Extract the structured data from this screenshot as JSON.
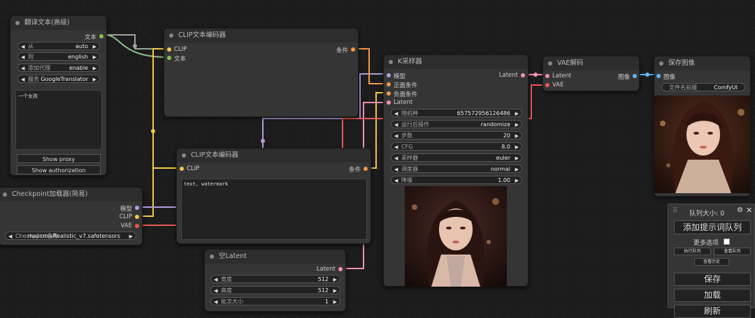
{
  "nodes": {
    "translate": {
      "title": "翻译文本(高级)",
      "out_text": "文本",
      "widgets": [
        {
          "label": "从",
          "value": "auto"
        },
        {
          "label": "到",
          "value": "english"
        },
        {
          "label": "添加代理",
          "value": "enable"
        },
        {
          "label": "服务",
          "value": "GoogleTranslator"
        }
      ],
      "text": "一个女孩",
      "btn_proxy": "Show proxy",
      "btn_auth": "Show authorization"
    },
    "clip1": {
      "title": "CLIP文本编码器",
      "in_clip": "CLIP",
      "in_text": "文本",
      "out_cond": "条件"
    },
    "clip2": {
      "title": "CLIP文本编码器",
      "in_clip": "CLIP",
      "out_cond": "条件",
      "text": "text, watermark"
    },
    "checkpoint": {
      "title": "Checkpoint加载器(简易)",
      "out_model": "模型",
      "out_clip": "CLIP",
      "out_vae": "VAE",
      "widget_label": "Checkpoint名称",
      "widget_value": "majicmixRealistic_v7.safetensors"
    },
    "empty_latent": {
      "title": "空Latent",
      "out_latent": "Latent",
      "widgets": [
        {
          "label": "宽度",
          "value": "512"
        },
        {
          "label": "高度",
          "value": "512"
        },
        {
          "label": "批次大小",
          "value": "1"
        }
      ]
    },
    "ksampler": {
      "title": "K采样器",
      "in_model": "模型",
      "in_pos": "正面条件",
      "in_neg": "负面条件",
      "in_latent": "Latent",
      "out_latent": "Latent",
      "widgets": [
        {
          "label": "随机种",
          "value": "657572956126486"
        },
        {
          "label": "运行后操作",
          "value": "randomize"
        },
        {
          "label": "步数",
          "value": "20"
        },
        {
          "label": "CFG",
          "value": "8.0"
        },
        {
          "label": "采样器",
          "value": "euler"
        },
        {
          "label": "调度器",
          "value": "normal"
        },
        {
          "label": "降噪",
          "value": "1.00"
        }
      ]
    },
    "vae_decode": {
      "title": "VAE解码",
      "in_latent": "Latent",
      "in_vae": "VAE",
      "out_image": "图像"
    },
    "save_image": {
      "title": "保存图像",
      "in_image": "图像",
      "widget_label": "文件名前缀",
      "widget_value": "ComfyUI"
    }
  },
  "queue_panel": {
    "queue_size": "队列大小: 0",
    "add_queue": "添加提示词队列",
    "more_options": "更多选项",
    "exec_queue": "执行队列",
    "view_queue": "查看队列",
    "view_history": "查看历史",
    "save": "保存",
    "load": "加载",
    "refresh": "刷新"
  },
  "colors": {
    "clip_wire": "#f2c94c",
    "model_wire": "#b39ddb",
    "cond_wire": "#f2994a",
    "latent_wire": "#f48fb1",
    "vae_wire": "#eb5757",
    "image_wire": "#64b5f6",
    "string_wire": "#8bc34a"
  }
}
